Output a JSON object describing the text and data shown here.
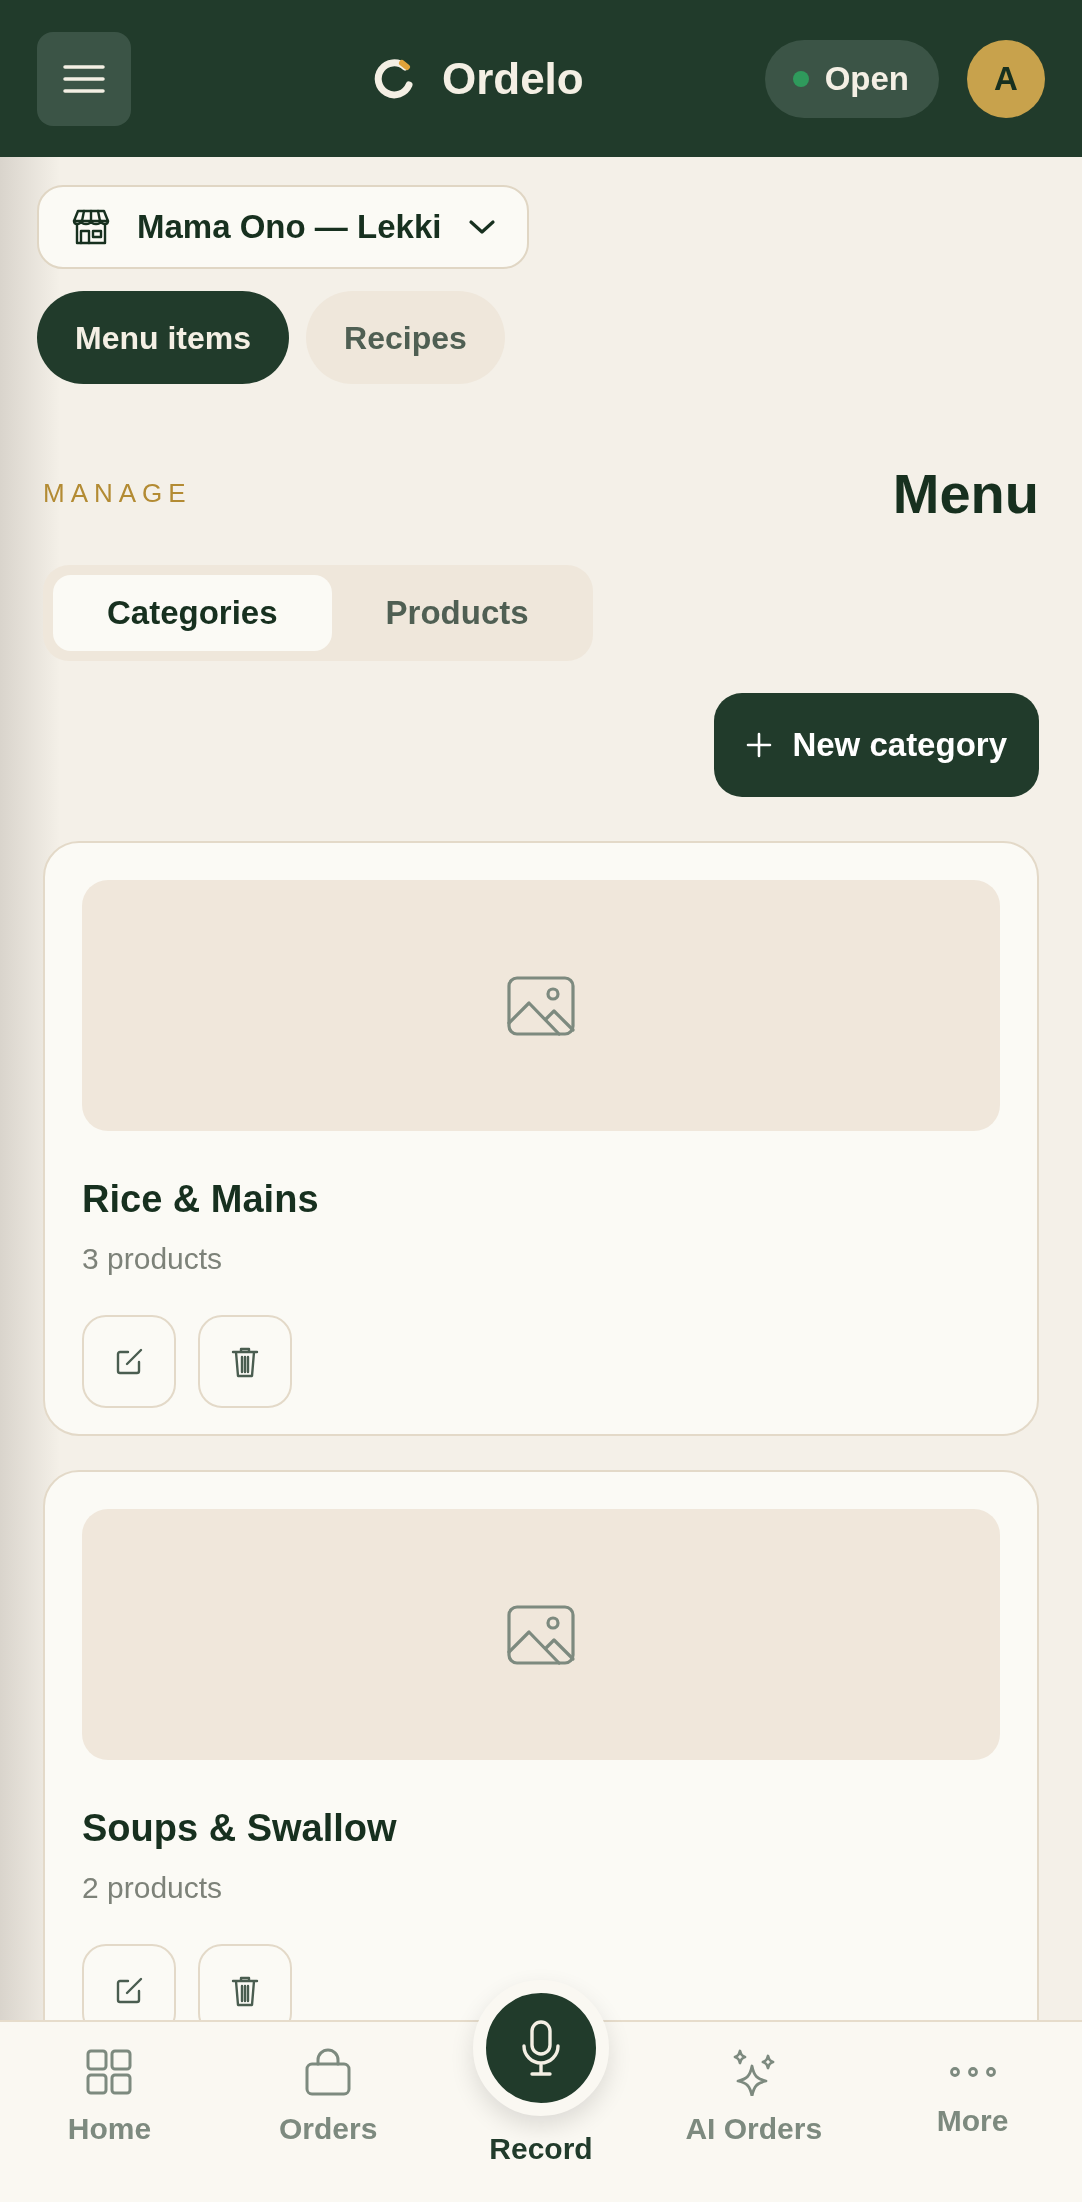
{
  "header": {
    "brand": "Ordelo",
    "status": {
      "label": "Open",
      "on": true
    },
    "avatar": "A"
  },
  "store_selector": {
    "label": "Mama Ono — Lekki"
  },
  "section_tabs": [
    {
      "label": "Menu items",
      "selected": true
    },
    {
      "label": "Recipes",
      "selected": false
    }
  ],
  "eyebrow": "MANAGE",
  "title": "Menu",
  "view_toggle": [
    {
      "label": "Categories",
      "selected": true
    },
    {
      "label": "Products",
      "selected": false
    }
  ],
  "new_button": "New category",
  "categories": [
    {
      "name": "Rice & Mains",
      "count": "3 products"
    },
    {
      "name": "Soups & Swallow",
      "count": "2 products"
    }
  ],
  "bottom_nav": [
    {
      "label": "Home",
      "kind": "tab"
    },
    {
      "label": "Orders",
      "kind": "tab"
    },
    {
      "label": "Record",
      "kind": "primary"
    },
    {
      "label": "AI Orders",
      "kind": "tab"
    },
    {
      "label": "More",
      "kind": "tab"
    }
  ]
}
